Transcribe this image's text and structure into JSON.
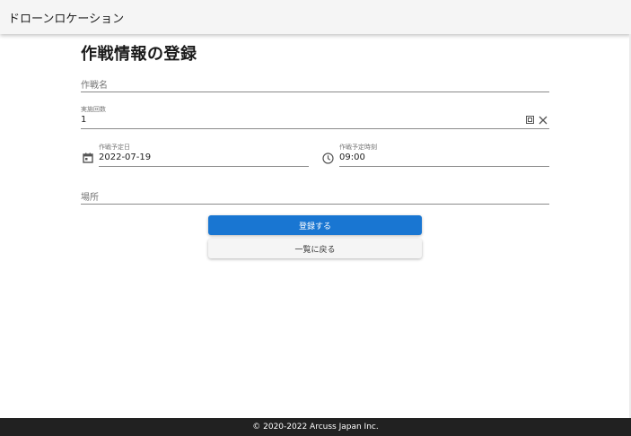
{
  "app": {
    "title": "ドローンロケーション"
  },
  "page": {
    "title": "作戦情報の登録"
  },
  "form": {
    "name_label": "作戦名",
    "count_label": "実施回数",
    "count_value": "1",
    "date_label": "作戦予定日",
    "date_value": "2022-07-19",
    "time_label": "作戦予定時刻",
    "time_value": "09:00",
    "place_label": "場所"
  },
  "buttons": {
    "submit_label": "登録する",
    "back_label": "一覧に戻る"
  },
  "footer": {
    "copyright": "© 2020-2022 Arcuss Japan Inc."
  },
  "icons": {
    "date": "calendar-icon",
    "time": "clock-icon",
    "counter": "counter-icon",
    "clear": "close-icon"
  },
  "colors": {
    "primary": "#1976d2",
    "footer_bg": "#212121"
  }
}
